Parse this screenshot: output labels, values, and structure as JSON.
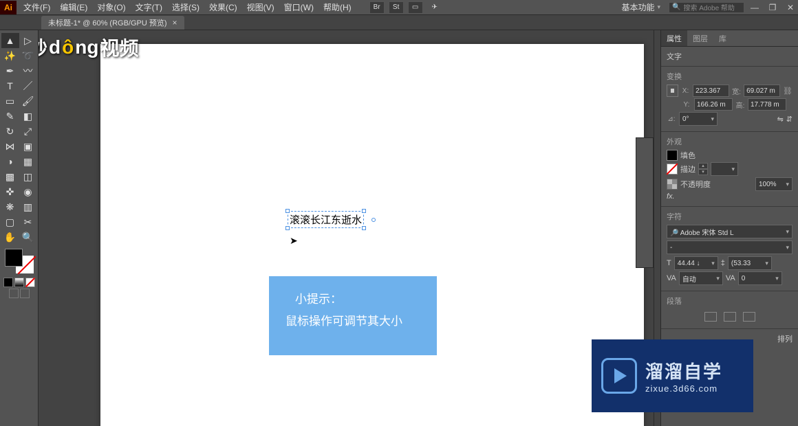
{
  "app_logo": "Ai",
  "menu": {
    "file": "文件(F)",
    "edit": "编辑(E)",
    "object": "对象(O)",
    "type": "文字(T)",
    "select": "选择(S)",
    "effect": "效果(C)",
    "view": "视图(V)",
    "window": "窗口(W)",
    "help": "帮助(H)"
  },
  "menu_icons": {
    "br": "Br",
    "st": "St"
  },
  "workspace_label": "基本功能",
  "search_placeholder": "搜索 Adobe 帮助",
  "doc_tab": {
    "title": "未标题-1* @ 60% (RGB/GPU 预览)",
    "close": "×"
  },
  "canvas": {
    "text_content": "滚滚长江东逝水",
    "tip_title": "小提示：",
    "tip_body": "鼠标操作可调节其大小"
  },
  "watermark": {
    "pre": "秒",
    "d": "d",
    "o": "ô",
    "ng": "ng",
    "suffix": "视频"
  },
  "panels": {
    "tabs": {
      "properties": "属性",
      "layers": "图层",
      "libraries": "库"
    },
    "section_type": "文字",
    "section_transform": "变换",
    "x_label": "X:",
    "x_value": "223.367",
    "w_label": "宽:",
    "w_value": "69.027 m",
    "y_label": "Y:",
    "y_value": "166.26 m",
    "h_label": "高:",
    "h_value": "17.778 m",
    "angle_label": "⊿:",
    "angle_value": "0°",
    "section_appearance": "外观",
    "fill_label": "填色",
    "stroke_label": "描边",
    "opacity_label": "不透明度",
    "opacity_value": "100%",
    "fx": "fx.",
    "section_char": "字符",
    "font_name": "Adobe 宋体 Std L",
    "font_style": "-",
    "font_size": "44.44 ↓",
    "leading": "(53.33",
    "tracking_auto": "自动",
    "tracking_val": "0",
    "section_align": "段落"
  },
  "right_extra": "排列",
  "brand": {
    "title": "溜溜自学",
    "url": "zixue.3d66.com"
  }
}
